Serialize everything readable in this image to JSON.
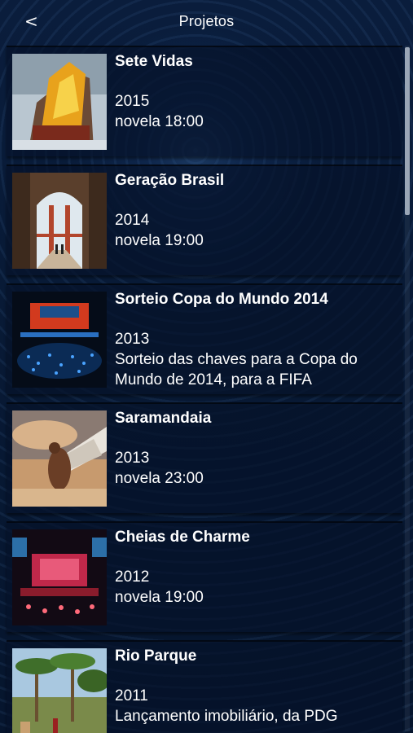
{
  "header": {
    "back_label": "<",
    "title": "Projetos"
  },
  "projects": [
    {
      "name": "Sete Vidas",
      "year": "2015",
      "desc": "novela 18:00",
      "thumb": "burning-ship"
    },
    {
      "name": "Geração Brasil",
      "year": "2014",
      "desc": "novela 19:00",
      "thumb": "golden-gate-bridge"
    },
    {
      "name": "Sorteio Copa do Mundo 2014",
      "year": "2013",
      "desc": "Sorteio das chaves para a Copa do Mundo de 2014, para a FIFA",
      "thumb": "stage-event"
    },
    {
      "name": "Saramandaia",
      "year": "2013",
      "desc": "novela 23:00",
      "thumb": "winged-man"
    },
    {
      "name": "Cheias de Charme",
      "year": "2012",
      "desc": "novela 19:00",
      "thumb": "concert-stage"
    },
    {
      "name": "Rio Parque",
      "year": "2011",
      "desc": "Lançamento imobiliário, da PDG",
      "thumb": "palm-trees"
    }
  ]
}
